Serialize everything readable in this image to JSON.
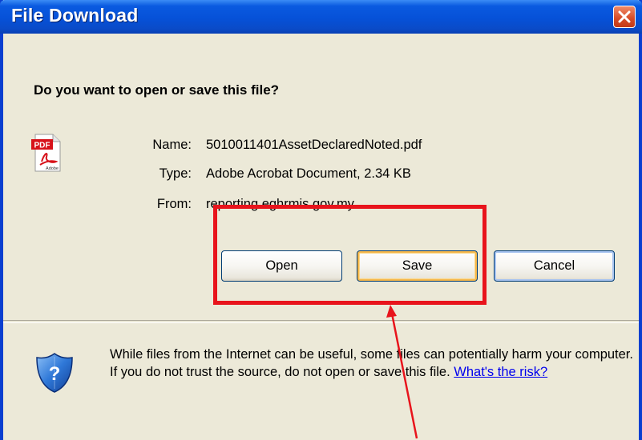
{
  "window": {
    "title": "File Download",
    "close_icon": "close-icon"
  },
  "dialog": {
    "heading": "Do you want to open or save this file?",
    "file_icon": "pdf-icon",
    "name_label": "Name:",
    "name_value": "5010011401AssetDeclaredNoted.pdf",
    "type_label": "Type:",
    "type_value": "Adobe Acrobat Document, 2.34 KB",
    "from_label": "From:",
    "from_value": "reporting.eghrmis.gov.my"
  },
  "buttons": {
    "open": "Open",
    "save": "Save",
    "cancel": "Cancel"
  },
  "warning": {
    "icon": "shield-icon",
    "text": "While files from the Internet can be useful, some files can potentially harm your computer. If you do not trust the source, do not open or save this file.",
    "link": "What's the risk?"
  },
  "annotation": {
    "highlight_color": "#e8141c",
    "arrow_color": "#e8141c"
  },
  "pdf_icon_text": {
    "badge": "PDF",
    "brand": "Adobe"
  },
  "colors": {
    "titlebar": "#0651d8",
    "dialog_bg": "#ece9d8",
    "close_button": "#d64a26"
  }
}
